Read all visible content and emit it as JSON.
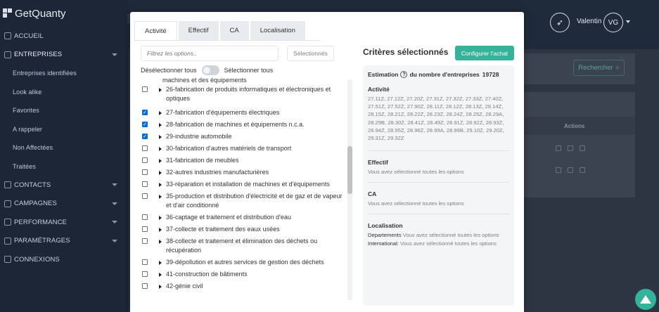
{
  "app": {
    "name": "GetQuanty"
  },
  "sidebar": {
    "items": [
      {
        "label": "ACCUEIL",
        "type": "section",
        "caret": false
      },
      {
        "label": "ENTREPRISES",
        "type": "section",
        "caret": true,
        "active": true
      },
      {
        "label": "Entreprises identifiées",
        "type": "sub"
      },
      {
        "label": "Look alike",
        "type": "sub"
      },
      {
        "label": "Favorites",
        "type": "sub"
      },
      {
        "label": "A rappeler",
        "type": "sub"
      },
      {
        "label": "Non Affectées",
        "type": "sub"
      },
      {
        "label": "Traitées",
        "type": "sub"
      },
      {
        "label": "CONTACTS",
        "type": "section",
        "caret": true
      },
      {
        "label": "CAMPAGNES",
        "type": "section",
        "caret": true
      },
      {
        "label": "PERFORMANCE",
        "type": "section",
        "caret": true
      },
      {
        "label": "PARAMÉTRAGES",
        "type": "section",
        "caret": true
      },
      {
        "label": "CONNEXIONS",
        "type": "section",
        "caret": false
      }
    ]
  },
  "header": {
    "user_name": "Valentin",
    "user_initials": "VG",
    "notif_icon": "rocket-icon"
  },
  "background_page": {
    "search_button": "Rechercher",
    "actions_label": "Actions"
  },
  "modal": {
    "tabs": [
      {
        "label": "Activité",
        "active": true
      },
      {
        "label": "Effectif",
        "active": false
      },
      {
        "label": "CA",
        "active": false
      },
      {
        "label": "Localisation",
        "active": false
      }
    ],
    "filter_placeholder": "Filtrez les options..",
    "selected_button": "Sélectionnés",
    "deselect_all": "Désélectionner tous",
    "select_all": "Sélectionner tous",
    "partial_option": "machines et des équipements",
    "options": [
      {
        "label": "26-fabrication de produits informatiques et électroniques et optiques",
        "checked": false
      },
      {
        "label": "27-fabrication d'équipements électriques",
        "checked": true
      },
      {
        "label": "28-fabrication de machines et équipements n.c.a.",
        "checked": true
      },
      {
        "label": "29-industrie automobile",
        "checked": true
      },
      {
        "label": "30-fabrication d'autres matériels de transport",
        "checked": false
      },
      {
        "label": "31-fabrication de meubles",
        "checked": false
      },
      {
        "label": "32-autres industries manufacturières",
        "checked": false
      },
      {
        "label": "33-réparation et installation de machines et d'équipements",
        "checked": false
      },
      {
        "label": "35-production et distribution d'électricité et de gaz et de vapeur et d'air conditionné",
        "checked": false
      },
      {
        "label": "36-captage et traitement et distribution d'eau",
        "checked": false
      },
      {
        "label": "37-collecte et traitement des eaux usées",
        "checked": false
      },
      {
        "label": "38-collecte et traitement et élimination des déchets ou récupération",
        "checked": false
      },
      {
        "label": "39-dépollution et autres services de gestion des déchets",
        "checked": false
      },
      {
        "label": "41-construction de bâtiments",
        "checked": false
      },
      {
        "label": "42-génie civil",
        "checked": false
      }
    ],
    "criteria": {
      "title": "Critères sélectionnés",
      "config_button": "Configurer l'achat",
      "estimation_label": "Estimation",
      "estimation_suffix": "du nombre d'entreprises",
      "estimation_value": "19728",
      "activite_title": "Activité",
      "activite_codes": "27.11Z, 27.12Z, 27.20Z, 27.31Z, 27.32Z, 27.33Z, 27.40Z, 27.51Z, 27.52Z, 27.90Z, 28.11Z, 28.12Z, 28.13Z, 28.14Z, 28.15Z, 28.21Z, 28.22Z, 28.23Z, 28.24Z, 28.25Z, 28.29A, 28.29B, 28.30Z, 28.41Z, 28.49Z, 28.91Z, 28.92Z, 28.93Z, 28.94Z, 28.95Z, 28.96Z, 28.99A, 28.99B, 29.10Z, 29.20Z, 29.31Z, 29.32Z",
      "effectif_title": "Effectif",
      "effectif_text": "Vous avez sélectionné toutes les options",
      "ca_title": "CA",
      "ca_text": "Vous avez sélectionné toutes les options",
      "loc_title": "Localisation",
      "loc_dep_label": "Departements",
      "loc_dep_text": "Vous avez sélectionné toutes les options",
      "loc_int_label": "International:",
      "loc_int_text": "Vous avez sélectionné toutes les options"
    }
  },
  "colors": {
    "accent": "#34b29a",
    "sidebar_bg": "#1c2636",
    "checkbox": "#0a6ed1"
  }
}
